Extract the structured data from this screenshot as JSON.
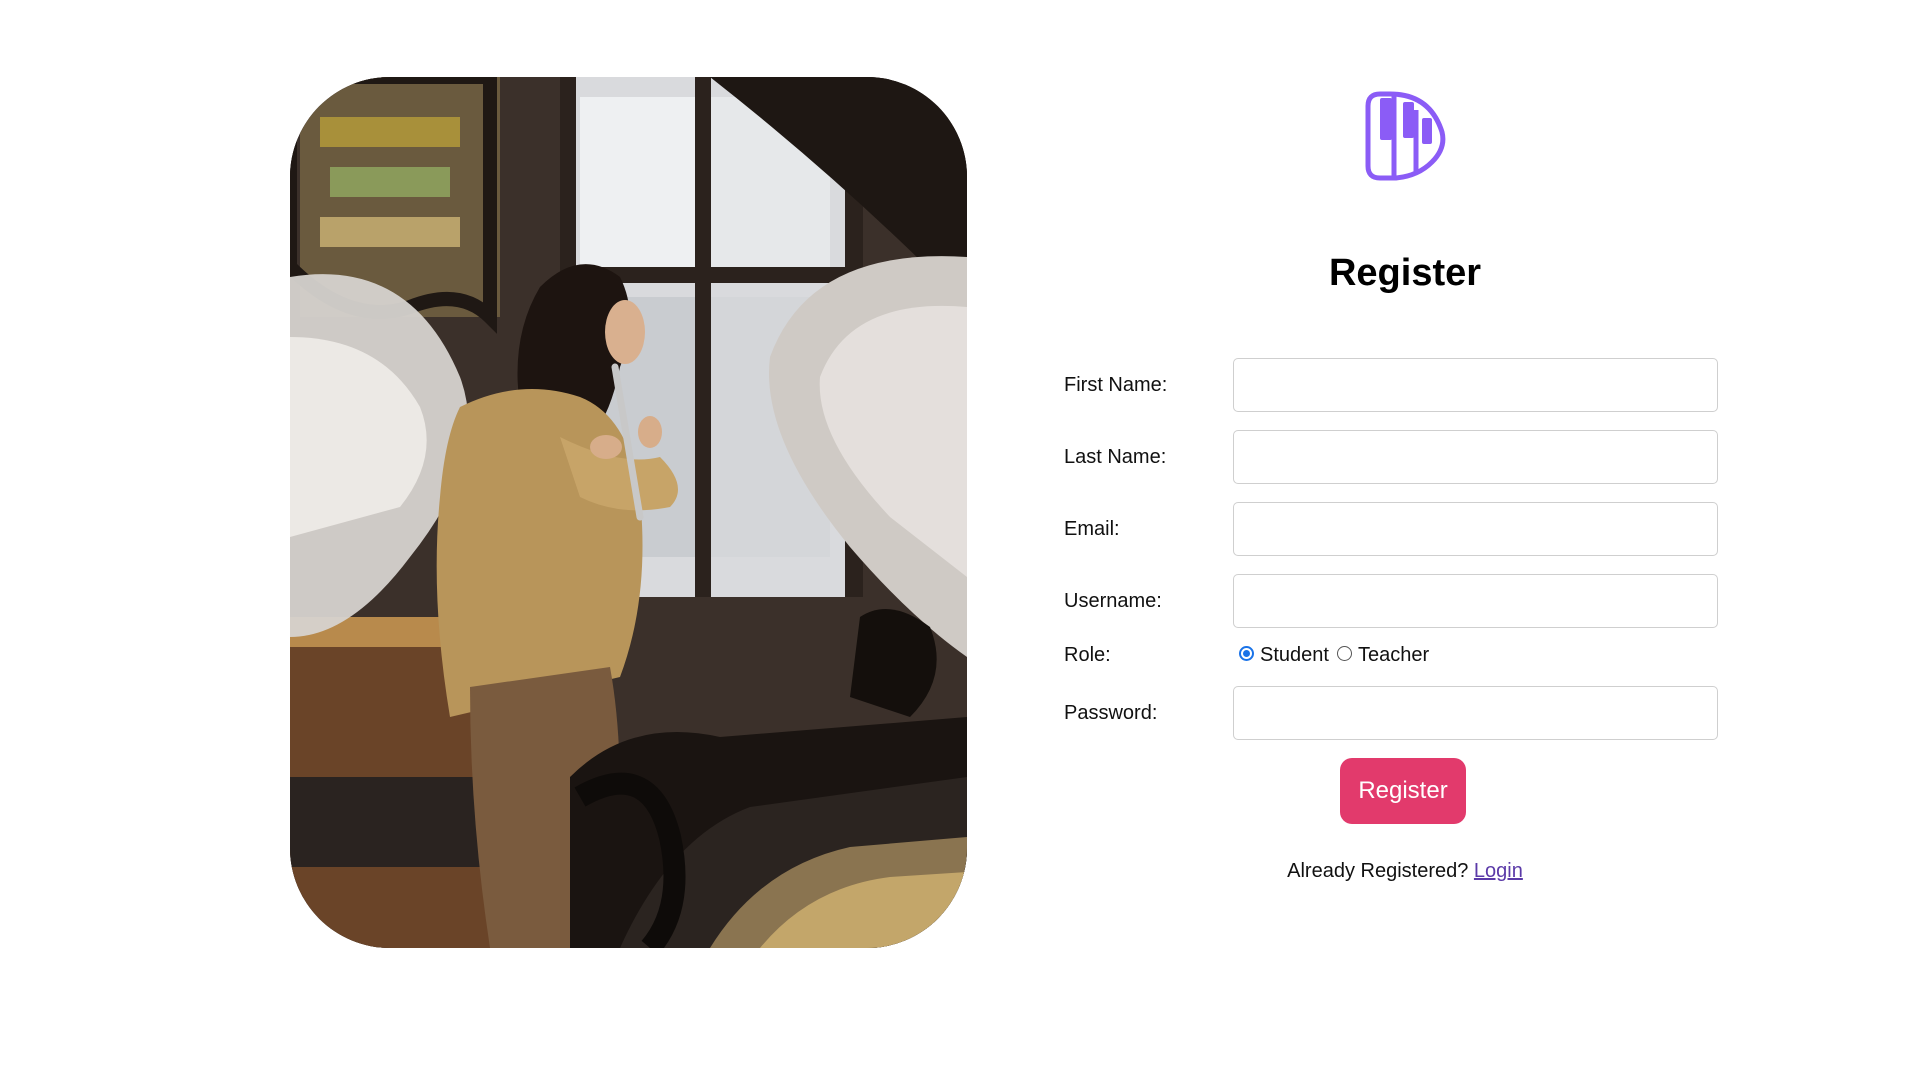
{
  "photo": {
    "alt": "Woman playing flute beside a grand piano"
  },
  "logo": {
    "icon": "piano-keys-logo-icon",
    "color": "#8b5cf6"
  },
  "form": {
    "title": "Register",
    "fields": {
      "first_name": {
        "label": "First Name:",
        "value": ""
      },
      "last_name": {
        "label": "Last Name:",
        "value": ""
      },
      "email": {
        "label": "Email:",
        "value": ""
      },
      "username": {
        "label": "Username:",
        "value": ""
      },
      "password": {
        "label": "Password:",
        "value": ""
      }
    },
    "role": {
      "label": "Role:",
      "options": [
        "Student",
        "Teacher"
      ],
      "selected": "Student"
    },
    "submit_label": "Register",
    "already_text": "Already Registered?",
    "login_link": "Login"
  },
  "colors": {
    "accent_button": "#e23a6c",
    "link": "#5b3aa8",
    "radio_checked": "#1a73e8"
  }
}
